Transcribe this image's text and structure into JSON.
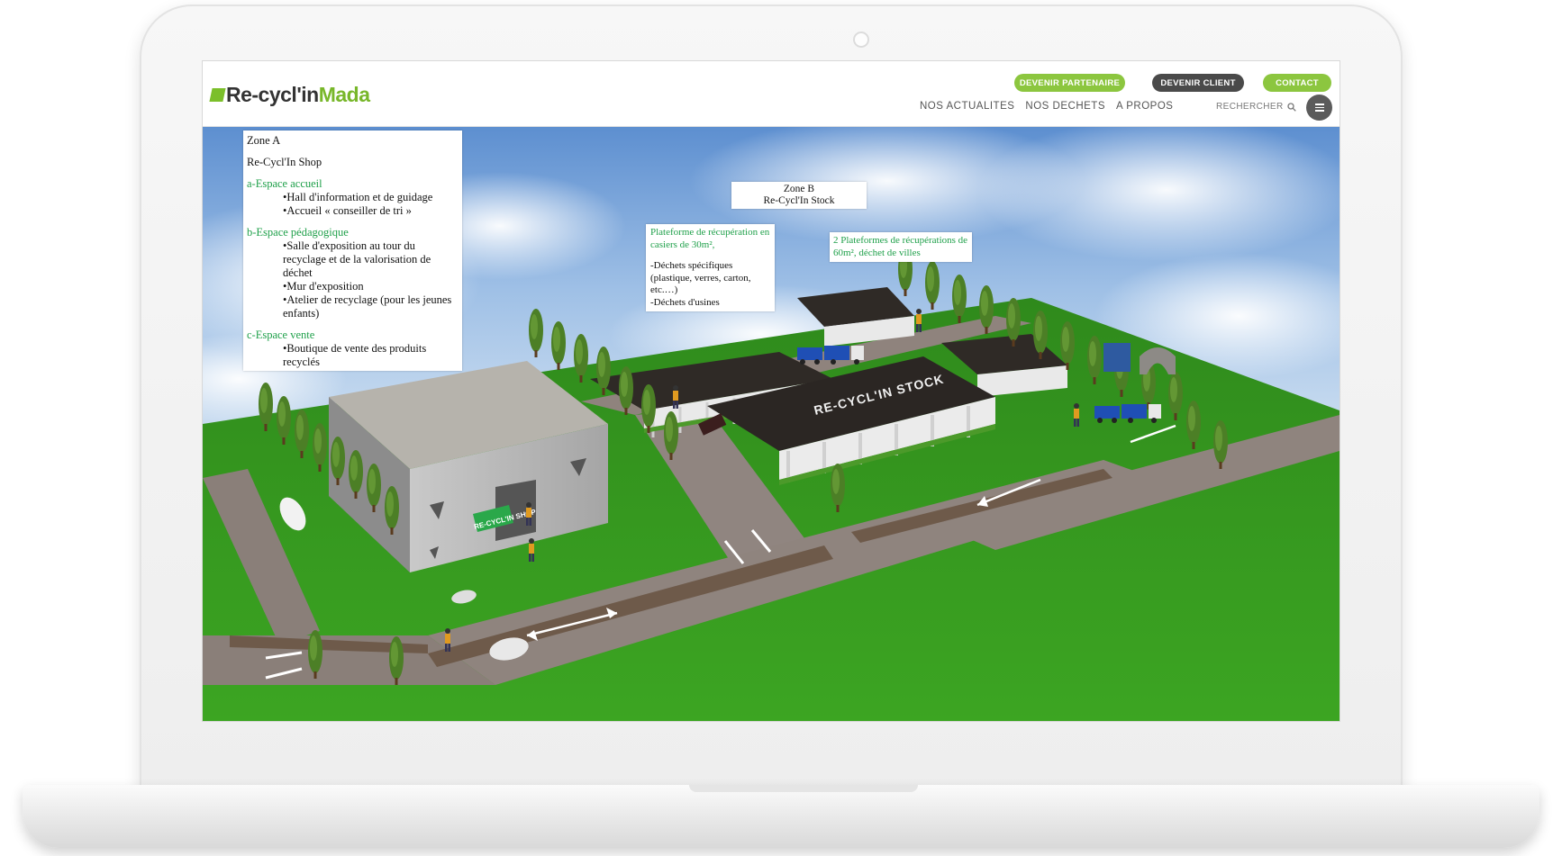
{
  "site": {
    "logo_text": "Re-cycl'in",
    "logo_accent": "Mada",
    "buttons": {
      "partenaire": "DEVENIR PARTENAIRE",
      "client": "DEVENIR CLIENT",
      "contact": "CONTACT"
    },
    "nav": [
      "NOS ACTUALITES",
      "NOS DECHETS",
      "A PROPOS"
    ],
    "search_label": "RECHERCHER",
    "colors": {
      "brand_green": "#8cc63f",
      "dark_button": "#4a4a4a",
      "annotation_green": "#1fa04a"
    },
    "icons": [
      "search-icon",
      "hamburger-menu-icon"
    ]
  },
  "scene": {
    "zone_a": {
      "title": "Zone A",
      "subtitle": "Re-Cycl'In Shop",
      "sections": [
        {
          "heading": "a-Espace accueil",
          "items": [
            "•Hall d'information et de guidage",
            "•Accueil «  conseiller de tri »"
          ]
        },
        {
          "heading": "b-Espace pédagogique",
          "items": [
            "•Salle d'exposition au tour du recyclage et de la valorisation de déchet",
            "•Mur d'exposition",
            "•Atelier de recyclage (pour les jeunes enfants)"
          ]
        },
        {
          "heading": "c-Espace vente",
          "items": [
            "•Boutique de vente des produits recyclés"
          ]
        }
      ]
    },
    "zone_b": {
      "title": "Zone B",
      "subtitle": "Re-Cycl'In Stock"
    },
    "plateforme_1": {
      "heading": "Plateforme de récupération en casiers de 30m²,",
      "lines": [
        "-Déchets spécifiques (plastique, verres, carton, etc.…)",
        "-Déchets d'usines"
      ]
    },
    "plateforme_2": {
      "heading": "2 Plateformes de récupérations de 60m², déchet de villes"
    },
    "building_signs": {
      "shop": "RE-CYCL'IN SHOP",
      "stock": "RE-CYCL'IN STOCK"
    }
  }
}
